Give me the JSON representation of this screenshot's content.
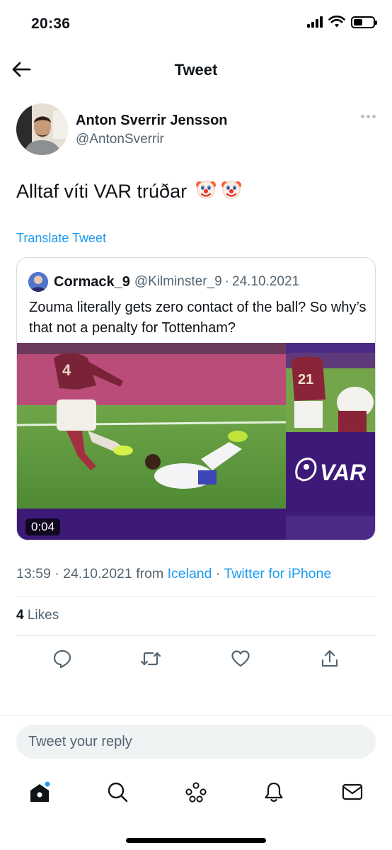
{
  "status_bar": {
    "time": "20:36"
  },
  "header": {
    "title": "Tweet"
  },
  "tweet": {
    "author_name": "Anton Sverrir Jensson",
    "author_handle": "@AntonSverrir",
    "text": "Alltaf víti VAR trúðar",
    "emojis": [
      "clown-face-icon",
      "clown-face-icon"
    ],
    "translate_label": "Translate Tweet",
    "time": "13:59",
    "date": "24.10.2021",
    "from_label": "from",
    "location": "Iceland",
    "source": "Twitter for iPhone",
    "likes_count": "4",
    "likes_label": "Likes"
  },
  "quote": {
    "name": "Cormack_9",
    "handle": "@Kilminster_9",
    "date": "24.10.2021",
    "text": "Zouma literally gets zero contact of the ball? So why’s that not a penalty for Tottenham?",
    "video_duration": "0:04",
    "media_overlay_text": "VAR",
    "player_number": "21"
  },
  "actions": [
    "reply-icon",
    "retweet-icon",
    "like-icon",
    "share-icon"
  ],
  "reply": {
    "placeholder": "Tweet your reply"
  },
  "tab_bar": {
    "items": [
      "home-icon",
      "search-icon",
      "spaces-icon",
      "notifications-icon",
      "messages-icon"
    ],
    "home_badge_color": "#1d9bf0"
  },
  "colors": {
    "accent": "#1d9bf0",
    "secondary_text": "#536471",
    "var_purple": "#3d1a78"
  }
}
